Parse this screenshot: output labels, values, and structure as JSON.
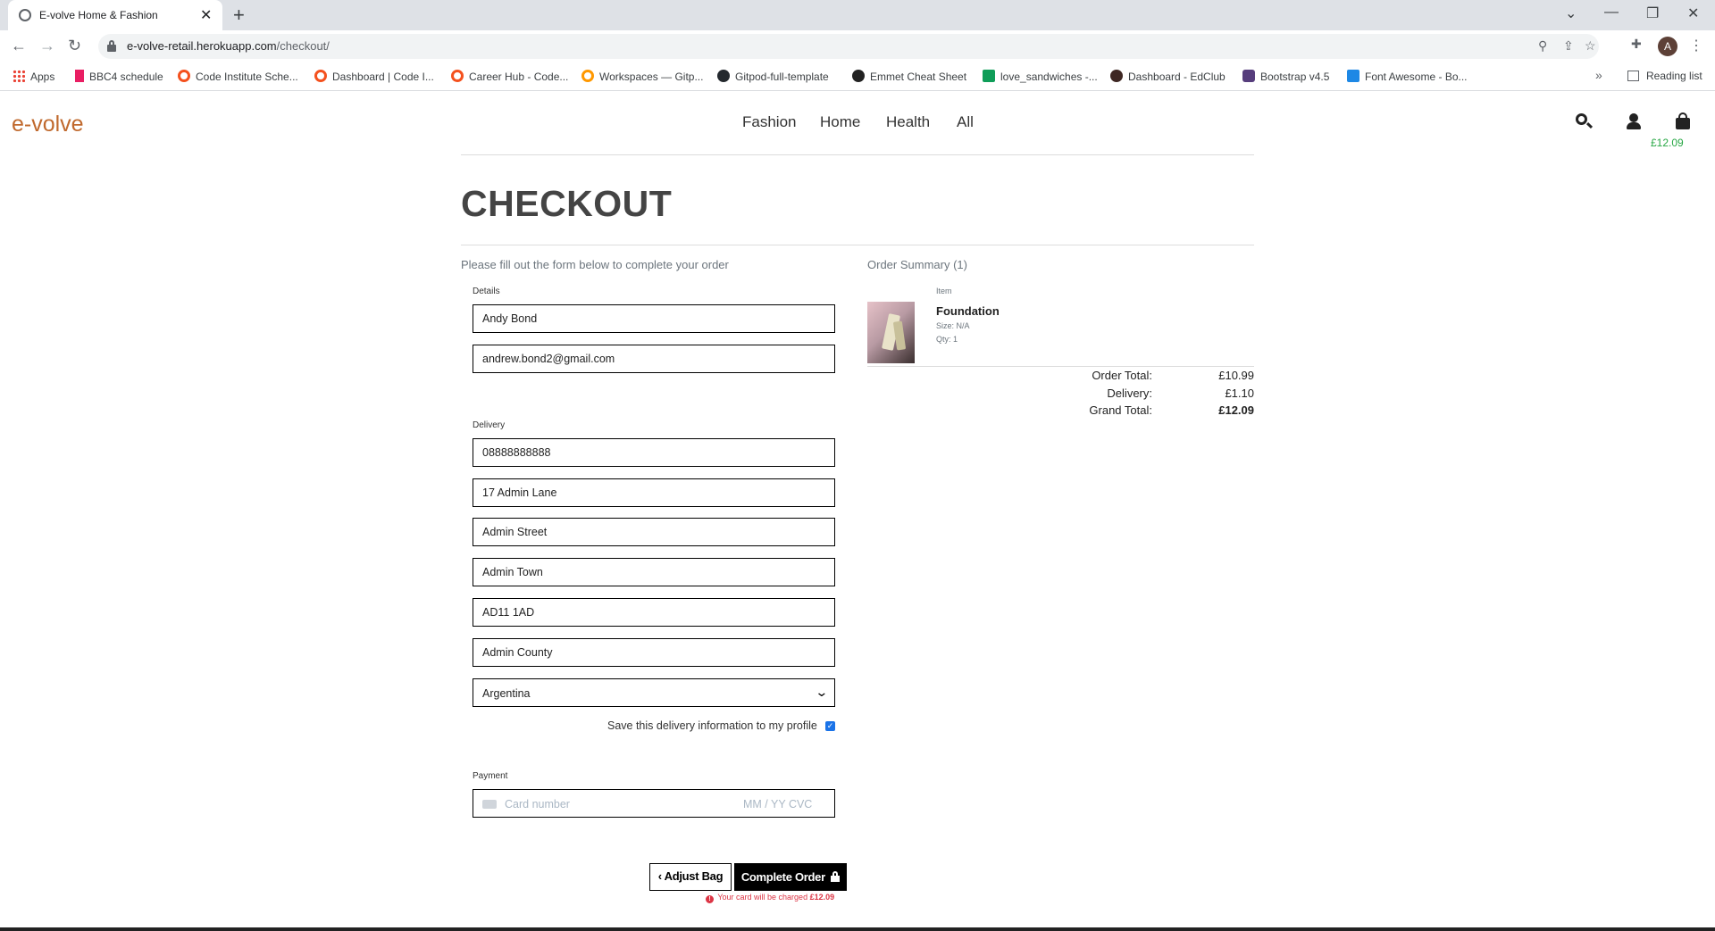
{
  "browser": {
    "tab_title": "E-volve Home & Fashion",
    "tab_close": "✕",
    "new_tab": "+",
    "url_host": "e-volve-retail.herokuapp.com",
    "url_path": "/checkout/",
    "avatar_initial": "A",
    "bookmarks": [
      {
        "label": "Apps"
      },
      {
        "label": "BBC4 schedule"
      },
      {
        "label": "Code Institute Sche..."
      },
      {
        "label": "Dashboard | Code I..."
      },
      {
        "label": "Career Hub - Code..."
      },
      {
        "label": "Workspaces — Gitp..."
      },
      {
        "label": "Gitpod-full-template"
      },
      {
        "label": "Emmet Cheat Sheet"
      },
      {
        "label": "love_sandwiches -..."
      },
      {
        "label": "Dashboard - EdClub"
      },
      {
        "label": "Bootstrap v4.5"
      },
      {
        "label": "Font Awesome - Bo..."
      }
    ],
    "bookmarks_more": "»",
    "reading_list": "Reading list"
  },
  "site": {
    "logo": "e-volve",
    "nav": [
      "Fashion",
      "Home",
      "Health",
      "All"
    ],
    "bag_total": "£12.09"
  },
  "checkout": {
    "title": "CHECKOUT",
    "intro": "Please fill out the form below to complete your order",
    "details_legend": "Details",
    "full_name": "Andy Bond",
    "email": "andrew.bond2@gmail.com",
    "delivery_legend": "Delivery",
    "phone": "08888888888",
    "street1": "17 Admin Lane",
    "street2": "Admin Street",
    "town": "Admin Town",
    "postcode": "AD11 1AD",
    "county": "Admin County",
    "country": "Argentina",
    "save_info_label": "Save this delivery information to my profile",
    "save_info_checked": true,
    "payment_legend": "Payment",
    "card_placeholder": "Card number",
    "card_expiry_cvc": "MM / YY  CVC",
    "adjust_bag": "Adjust Bag",
    "complete_order": "Complete Order",
    "charge_note_prefix": "Your card will be charged",
    "charge_amount": "£12.09"
  },
  "summary": {
    "title": "Order Summary (1)",
    "item_header": "Item",
    "product_name": "Foundation",
    "product_size": "Size: N/A",
    "product_qty": "Qty: 1",
    "order_total_label": "Order Total:",
    "order_total": "£10.99",
    "delivery_label": "Delivery:",
    "delivery": "£1.10",
    "grand_total_label": "Grand Total:",
    "grand_total": "£12.09"
  },
  "colors": {
    "brand": "#c0692d",
    "bag_total": "#28a745",
    "danger": "#dc3545"
  }
}
